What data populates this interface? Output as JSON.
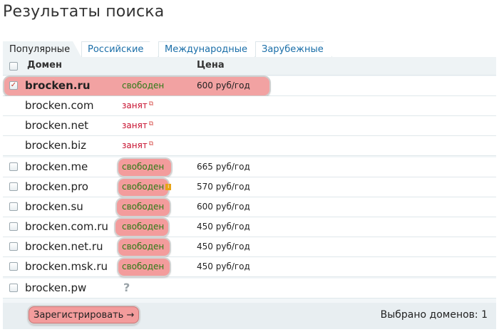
{
  "page": {
    "title": "Результаты поиска"
  },
  "tabs": [
    {
      "label": "Популярные",
      "active": true
    },
    {
      "label": "Российские",
      "active": false
    },
    {
      "label": "Международные",
      "active": false
    },
    {
      "label": "Зарубежные",
      "active": false
    }
  ],
  "table": {
    "headers": {
      "domain": "Домен",
      "price": "Цена"
    },
    "rows": [
      {
        "domain": "brocken.ru",
        "status": "свободен",
        "price": "600 руб/год",
        "checked": true,
        "has_checkbox": true,
        "highlight": "row"
      },
      {
        "domain": "brocken.com",
        "status": "занят",
        "price": "",
        "has_checkbox": false
      },
      {
        "domain": "brocken.net",
        "status": "занят",
        "price": "",
        "has_checkbox": false
      },
      {
        "domain": "brocken.biz",
        "status": "занят",
        "price": "",
        "has_checkbox": false
      },
      {
        "domain": "brocken.me",
        "status": "свободен",
        "price": "665 руб/год",
        "has_checkbox": true
      },
      {
        "domain": "brocken.pro",
        "status": "свободен",
        "price": "570 руб/год",
        "has_checkbox": true,
        "info_badge": "i"
      },
      {
        "domain": "brocken.su",
        "status": "свободен",
        "price": "600 руб/год",
        "has_checkbox": true
      },
      {
        "domain": "brocken.com.ru",
        "status": "свободен",
        "price": "450 руб/год",
        "has_checkbox": true
      },
      {
        "domain": "brocken.net.ru",
        "status": "свободен",
        "price": "450 руб/год",
        "has_checkbox": true
      },
      {
        "domain": "brocken.msk.ru",
        "status": "свободен",
        "price": "450 руб/год",
        "has_checkbox": true
      },
      {
        "domain": "brocken.pw",
        "status": "?",
        "price": "",
        "has_checkbox": true
      }
    ]
  },
  "footer": {
    "register_label": "Зарегистрировать →",
    "selected_count_label": "Выбрано доменов: 1"
  },
  "colors": {
    "accent_link": "#1a6ea8",
    "taken": "#c8102e",
    "free": "#2d7a16",
    "highlight": "#f39c9c",
    "panel": "#eef3f5"
  },
  "icons": {
    "checkbox_checked": "check-icon",
    "external_link": "external-link-icon",
    "unknown": "question-icon",
    "info": "info-icon"
  }
}
